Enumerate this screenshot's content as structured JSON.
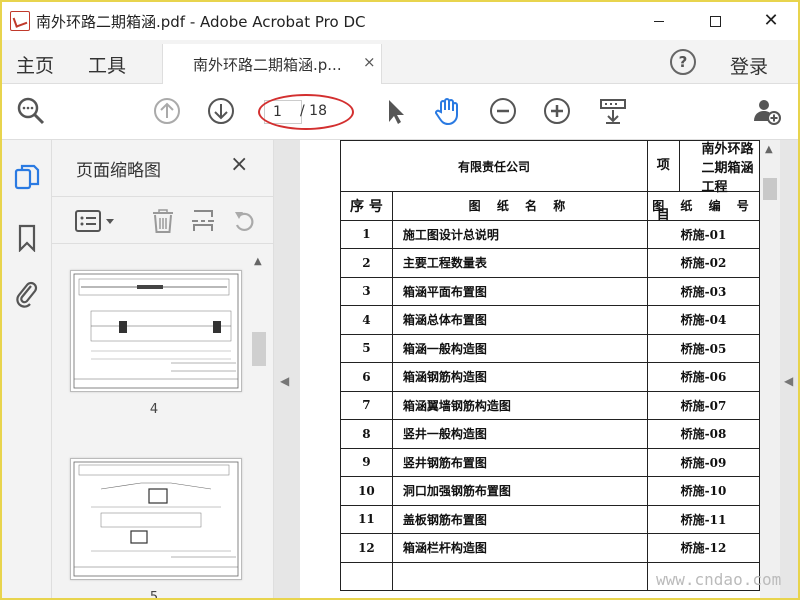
{
  "window": {
    "title": "南外环路二期箱涵.pdf - Adobe Acrobat Pro DC",
    "minimize_icon": "minimize-icon",
    "maximize_icon": "maximize-icon",
    "close_icon": "close-icon"
  },
  "menu": {
    "home": "主页",
    "tools": "工具",
    "tab_label": "南外环路二期箱涵.p...",
    "tab_close": "×",
    "help": "?",
    "login": "登录"
  },
  "toolbar": {
    "current_page": "1",
    "total_pages": "/ 18",
    "highlight_color": "#d32f2f",
    "accent_color": "#2a7ae2"
  },
  "panel": {
    "title": "页面缩略图",
    "close": "×",
    "thumbnails": [
      {
        "page_number": "4"
      },
      {
        "page_number": "5"
      }
    ]
  },
  "document": {
    "company_text": "有限责任公司",
    "project_label": "项　目",
    "project_name": "南外环路二期箱涵工程",
    "col_no": "序 号",
    "col_name": "图 纸 名 称",
    "col_code": "图 纸 编 号",
    "rows": [
      {
        "no": "1",
        "name": "施工图设计总说明",
        "code": "桥施-01"
      },
      {
        "no": "2",
        "name": "主要工程数量表",
        "code": "桥施-02"
      },
      {
        "no": "3",
        "name": "箱涵平面布置图",
        "code": "桥施-03"
      },
      {
        "no": "4",
        "name": "箱涵总体布置图",
        "code": "桥施-04"
      },
      {
        "no": "5",
        "name": "箱涵一般构造图",
        "code": "桥施-05"
      },
      {
        "no": "6",
        "name": "箱涵钢筋构造图",
        "code": "桥施-06"
      },
      {
        "no": "7",
        "name": "箱涵翼墙钢筋构造图",
        "code": "桥施-07"
      },
      {
        "no": "8",
        "name": "竖井一般构造图",
        "code": "桥施-08"
      },
      {
        "no": "9",
        "name": "竖井钢筋布置图",
        "code": "桥施-09"
      },
      {
        "no": "10",
        "name": "洞口加强钢筋布置图",
        "code": "桥施-10"
      },
      {
        "no": "11",
        "name": "盖板钢筋布置图",
        "code": "桥施-11"
      },
      {
        "no": "12",
        "name": "箱涵栏杆构造图",
        "code": "桥施-12"
      }
    ]
  },
  "watermark": "www.cndao.com"
}
